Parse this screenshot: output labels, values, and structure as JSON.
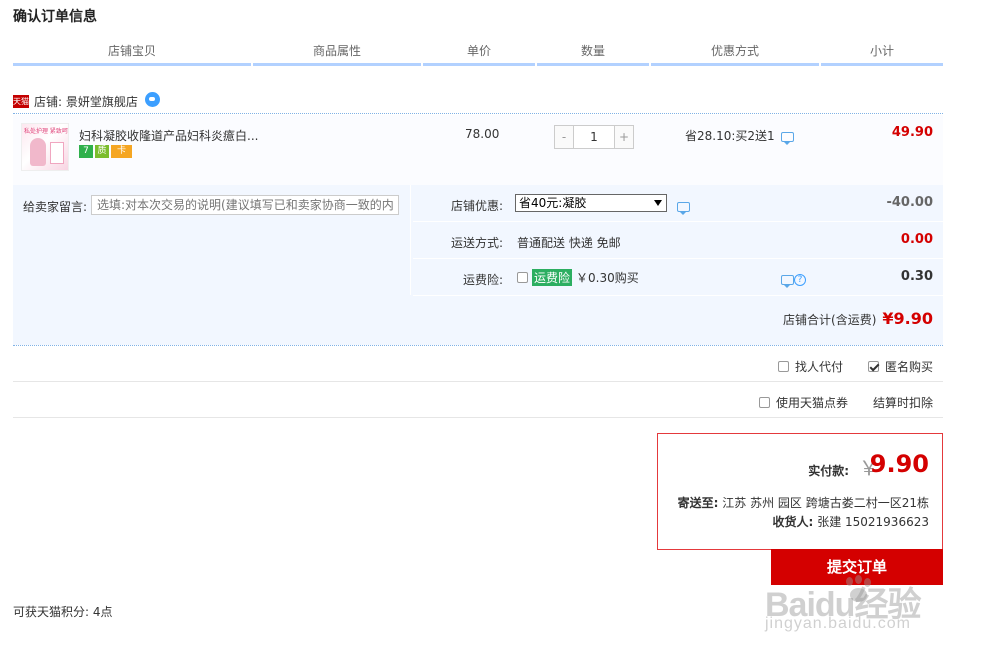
{
  "page_title": "确认订单信息",
  "columns": [
    "店铺宝贝",
    "商品属性",
    "单价",
    "数量",
    "优惠方式",
    "小计"
  ],
  "shop": {
    "badge": "天猫",
    "label": "店铺: 景妍堂旗舰店"
  },
  "item": {
    "thumb_text": "私处护理 紧致呵护",
    "title": "妇科凝胶收隆道产品妇科炎癔白...",
    "service_icons": [
      "7",
      "质",
      "卡"
    ],
    "price": "78.00",
    "qty_minus": "-",
    "qty": "1",
    "qty_plus": "+",
    "promo": "省28.10:买2送1",
    "subtotal": "49.90"
  },
  "message": {
    "label": "给卖家留言:",
    "placeholder": "选填:对本次交易的说明(建议填写已和卖家协商一致的内容)"
  },
  "shop_discount": {
    "label": "店铺优惠:",
    "selected": "省40元:凝胶",
    "amount": "-40.00"
  },
  "shipping": {
    "label": "运送方式:",
    "value": "普通配送 快递 免邮",
    "amount": "0.00"
  },
  "insurance": {
    "label": "运费险:",
    "badge": "运费险",
    "value": "￥0.30购买",
    "amount": "0.30"
  },
  "shop_total": {
    "label": "店铺合计(含运费)",
    "amount": "¥9.90"
  },
  "proxy_pay": {
    "label": "找人代付",
    "checked": false
  },
  "anonymous": {
    "label": "匿名购买",
    "checked": true
  },
  "points_coupon": {
    "label": "使用天猫点券",
    "note": "结算时扣除",
    "checked": false
  },
  "summary": {
    "pay_label": "实付款:",
    "yen": "￥",
    "pay_amount": "9.90",
    "ship_to_label": "寄送至:",
    "ship_to": "江苏 苏州 园区 跨塘古娄二村一区21栋",
    "receiver_label": "收货人:",
    "receiver": "张建 15021936623"
  },
  "submit_label": "提交订单",
  "points_text": "可获天猫积分: 4点",
  "watermark": {
    "text": "Baidu经验",
    "url": "jingyan.baidu.com"
  },
  "colors": {
    "accent": "#d40000",
    "header_rule": "#b2d1ff",
    "panel": "#f2f7ff",
    "insurance": "#2cae61"
  }
}
